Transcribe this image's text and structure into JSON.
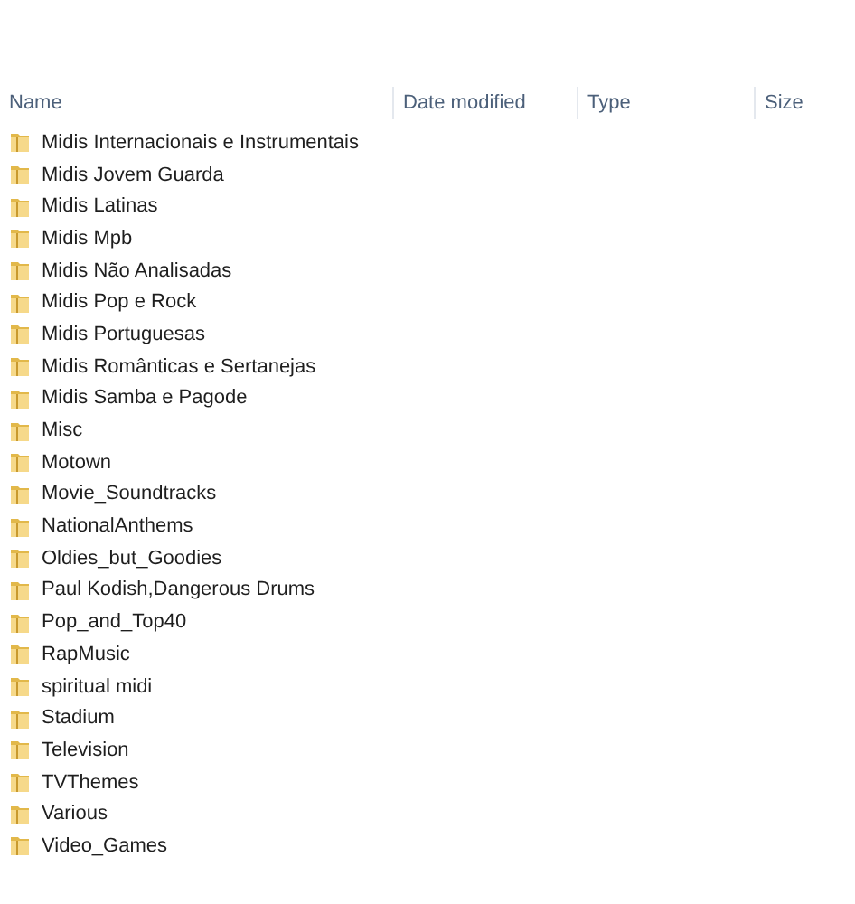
{
  "columns": [
    {
      "label": "Name"
    },
    {
      "label": "Date modified"
    },
    {
      "label": "Type"
    },
    {
      "label": "Size"
    }
  ],
  "folders": [
    {
      "name": "Midis Internacionais e Instrumentais"
    },
    {
      "name": "Midis Jovem Guarda"
    },
    {
      "name": "Midis Latinas"
    },
    {
      "name": "Midis Mpb"
    },
    {
      "name": "Midis Não Analisadas"
    },
    {
      "name": "Midis Pop e Rock"
    },
    {
      "name": "Midis Portuguesas"
    },
    {
      "name": "Midis Românticas e Sertanejas"
    },
    {
      "name": "Midis Samba e Pagode"
    },
    {
      "name": "Misc"
    },
    {
      "name": "Motown"
    },
    {
      "name": "Movie_Soundtracks"
    },
    {
      "name": "NationalAnthems"
    },
    {
      "name": "Oldies_but_Goodies"
    },
    {
      "name": "Paul Kodish,Dangerous Drums"
    },
    {
      "name": "Pop_and_Top40"
    },
    {
      "name": "RapMusic"
    },
    {
      "name": "spiritual midi"
    },
    {
      "name": "Stadium"
    },
    {
      "name": "Television"
    },
    {
      "name": "TVThemes"
    },
    {
      "name": "Various"
    },
    {
      "name": "Video_Games"
    }
  ]
}
